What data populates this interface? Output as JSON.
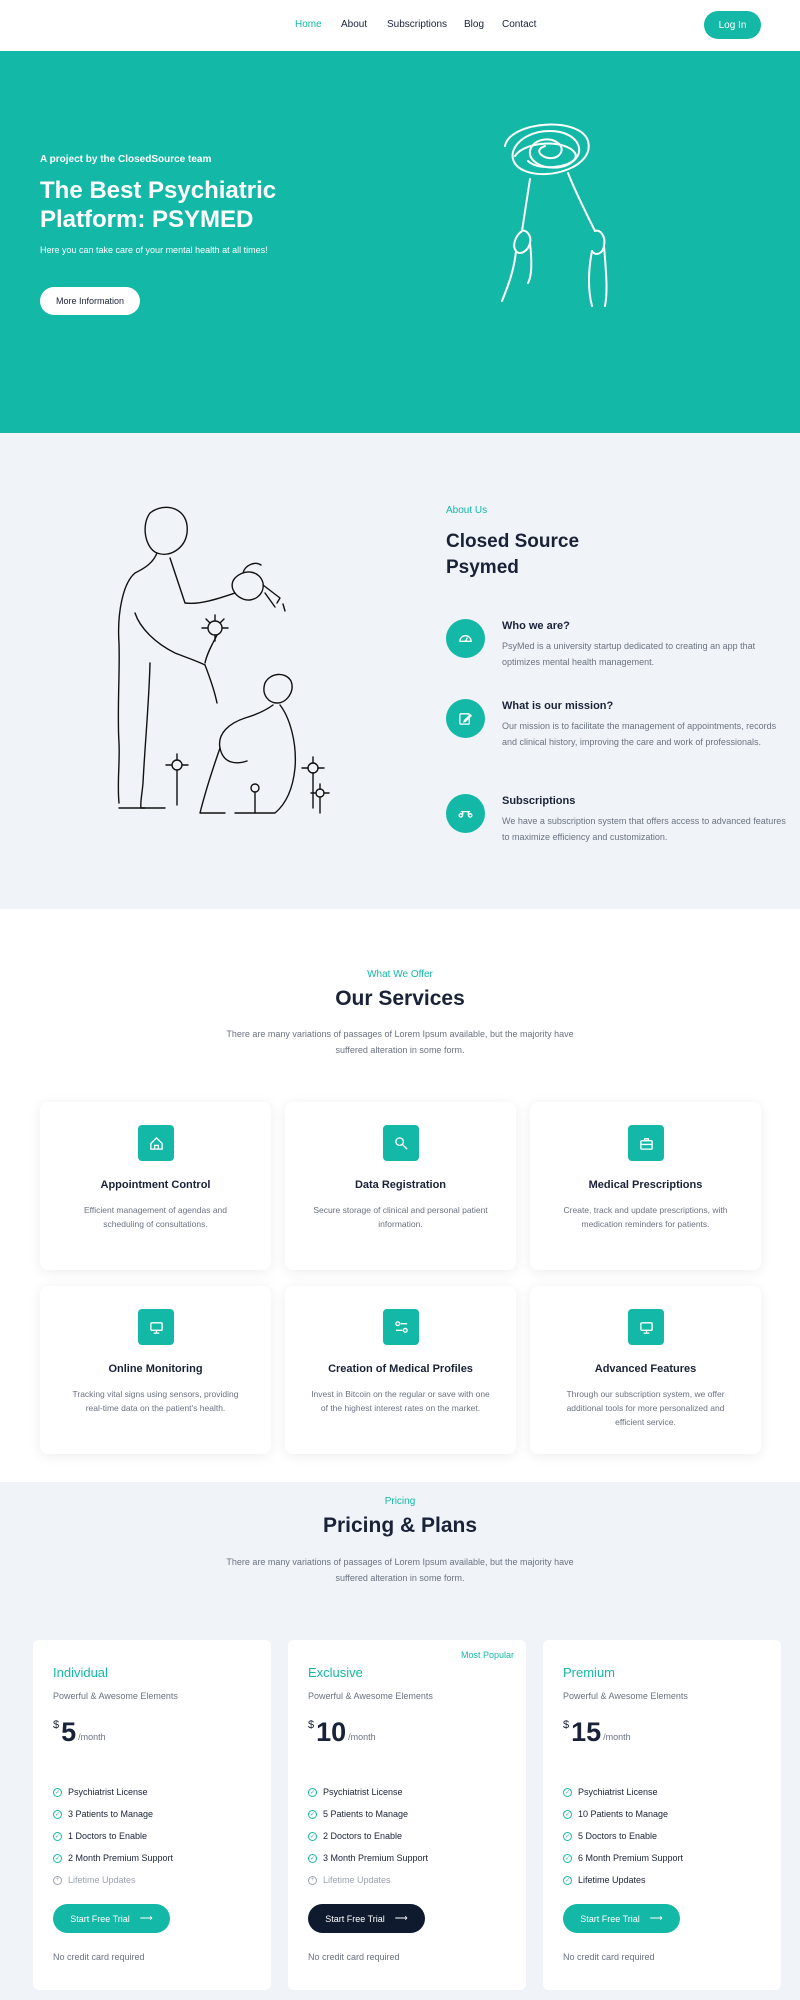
{
  "nav": {
    "links": [
      "Home",
      "About",
      "Subscriptions",
      "Blog",
      "Contact"
    ],
    "login": "Log In"
  },
  "hero": {
    "eyebrow": "A project by the ClosedSource team",
    "title": "The Best Psychiatric Platform: PSYMED",
    "subtitle": "Here you can take care of your mental health at all times!",
    "button": "More Information"
  },
  "about": {
    "eyebrow": "About Us",
    "title_line1": "Closed Source",
    "title_line2": "Psymed",
    "features": [
      {
        "icon": "dashboard-icon",
        "title": "Who we are?",
        "text": "PsyMed is a university startup dedicated to creating an app that optimizes mental health management."
      },
      {
        "icon": "edit-icon",
        "title": "What is our mission?",
        "text": "Our mission is to facilitate the management of appointments, records and clinical history, improving the care and work of professionals."
      },
      {
        "icon": "subscription-icon",
        "title": "Subscriptions",
        "text": "We have a subscription system that offers access to advanced features to maximize efficiency and customization."
      }
    ]
  },
  "services": {
    "eyebrow": "What We Offer",
    "title": "Our Services",
    "subtitle": "There are many variations of passages of Lorem Ipsum available, but the majority have suffered alteration in some form.",
    "cards": [
      {
        "icon": "home-icon",
        "title": "Appointment Control",
        "text": "Efficient management of agendas and scheduling of consultations."
      },
      {
        "icon": "search-icon",
        "title": "Data Registration",
        "text": "Secure storage of clinical and personal patient information."
      },
      {
        "icon": "briefcase-icon",
        "title": "Medical Prescriptions",
        "text": "Create, track and update prescriptions, with medication reminders for patients."
      },
      {
        "icon": "monitor-icon",
        "title": "Online Monitoring",
        "text": "Tracking vital signs using sensors, providing real-time data on the patient's health."
      },
      {
        "icon": "profile-settings-icon",
        "title": "Creation of Medical Profiles",
        "text": "Invest in Bitcoin on the regular or save with one of the highest interest rates on the market."
      },
      {
        "icon": "monitor-icon",
        "title": "Advanced Features",
        "text": "Through our subscription system, we offer additional tools for more personalized and efficient service."
      }
    ]
  },
  "pricing": {
    "eyebrow": "Pricing",
    "title": "Pricing & Plans",
    "subtitle": "There are many variations of passages of Lorem Ipsum available, but the majority have suffered alteration in some form.",
    "plans": [
      {
        "name": "Individual",
        "badge": "",
        "desc": "Powerful & Awesome Elements",
        "currency": "$",
        "amount": "5",
        "per": "/month",
        "features": [
          "Psychiatrist License",
          "3 Patients to Manage",
          "1 Doctors to Enable",
          "2 Month Premium Support",
          "Lifetime Updates"
        ],
        "button": "Start Free Trial",
        "note": "No credit card required"
      },
      {
        "name": "Exclusive",
        "badge": "Most Popular",
        "desc": "Powerful & Awesome Elements",
        "currency": "$",
        "amount": "10",
        "per": "/month",
        "features": [
          "Psychiatrist License",
          "5 Patients to Manage",
          "2 Doctors to Enable",
          "3 Month Premium Support",
          "Lifetime Updates"
        ],
        "button": "Start Free Trial",
        "note": "No credit card required"
      },
      {
        "name": "Premium",
        "badge": "",
        "desc": "Powerful & Awesome Elements",
        "currency": "$",
        "amount": "15",
        "per": "/month",
        "features": [
          "Psychiatrist License",
          "10 Patients to Manage",
          "5 Doctors to Enable",
          "6 Month Premium Support",
          "Lifetime Updates"
        ],
        "button": "Start Free Trial",
        "note": "No credit card required"
      }
    ]
  },
  "colors": {
    "accent": "#14b8a6",
    "dark": "#0f1a2e",
    "light_bg": "#f0f4f8"
  }
}
